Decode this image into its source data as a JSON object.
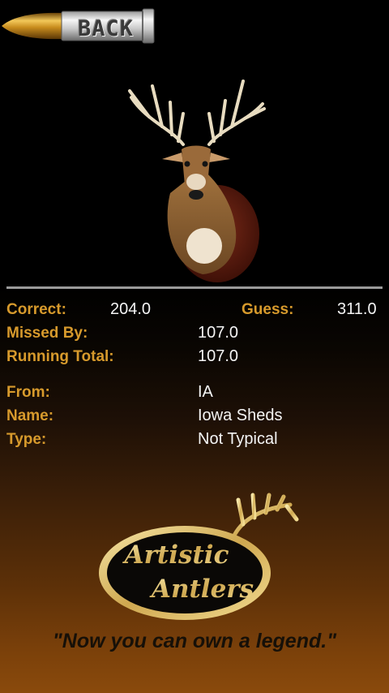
{
  "header": {
    "back_label": "BACK"
  },
  "stats": {
    "correct_label": "Correct:",
    "correct_value": "204.0",
    "guess_label": "Guess:",
    "guess_value": "311.0",
    "missed_label": "Missed By:",
    "missed_value": "107.0",
    "running_label": "Running Total:",
    "running_value": "107.0"
  },
  "details": {
    "from_label": "From:",
    "from_value": "IA",
    "name_label": "Name:",
    "name_value": "Iowa Sheds",
    "type_label": "Type:",
    "type_value": "Not Typical"
  },
  "brand": {
    "logo_line1": "Artistic",
    "logo_line2": "Antlers",
    "tagline": "\"Now you can own a legend.\""
  },
  "colors": {
    "label": "#d79a2c",
    "value": "#f4f4f4",
    "divider": "#9a9a9a"
  }
}
